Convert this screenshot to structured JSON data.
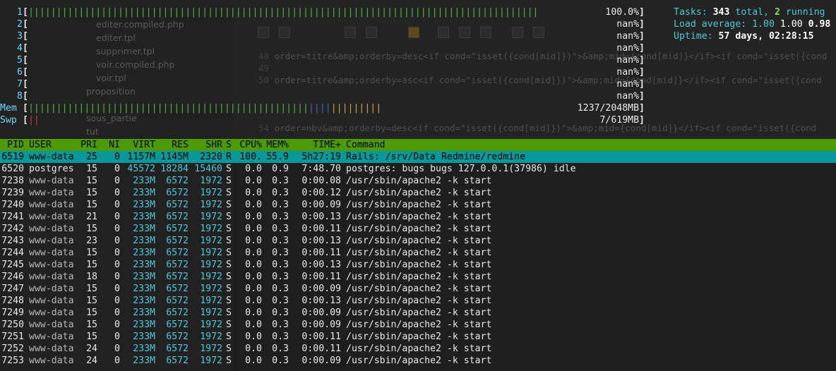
{
  "cpu_meters": [
    {
      "label": "1",
      "value": "100.0%",
      "full": true
    },
    {
      "label": "2",
      "value": "nan%",
      "full": false
    },
    {
      "label": "3",
      "value": "nan%",
      "full": false
    },
    {
      "label": "4",
      "value": "nan%",
      "full": false
    },
    {
      "label": "5",
      "value": "nan%",
      "full": false
    },
    {
      "label": "6",
      "value": "nan%",
      "full": false
    },
    {
      "label": "7",
      "value": "nan%",
      "full": false
    },
    {
      "label": "8",
      "value": "nan%",
      "full": false
    }
  ],
  "mem_meter": {
    "label": "Mem",
    "value": "1237/2048MB",
    "fraction": 0.6
  },
  "swap_meter": {
    "label": "Swp",
    "value": "7/619MB",
    "fraction": 0.01
  },
  "summary": {
    "tasks_label": "Tasks:",
    "tasks_total": "343",
    "tasks_total_suffix": "total,",
    "tasks_running": "2",
    "tasks_running_suffix": "running",
    "load_label": "Load average:",
    "load_1": "1.00",
    "load_5": "1.00",
    "load_15": "0.98",
    "uptime_label": "Uptime:",
    "uptime_value": "57 days, 02:28:15"
  },
  "columns": [
    "PID",
    "USER",
    "PRI",
    "NI",
    "VIRT",
    "RES",
    "SHR",
    "S",
    "CPU%",
    "MEM%",
    "TIME+",
    "Command"
  ],
  "processes": [
    {
      "pid": "6519",
      "user": "www-data",
      "pri": "25",
      "ni": "0",
      "virt": "1157M",
      "res": "1145M",
      "shr": "2320",
      "s": "R",
      "cpu": "100.",
      "mem": "55.9",
      "time": "5h27:19",
      "command": "Rails: /srv/Data Redmine/redmine",
      "selected": true
    },
    {
      "pid": "6520",
      "user": "postgres",
      "pri": "15",
      "ni": "0",
      "virt": "45572",
      "res": "18284",
      "shr": "15460",
      "s": "S",
      "cpu": "0.0",
      "mem": "0.9",
      "time": "7:48.70",
      "command": "postgres: bugs bugs 127.0.0.1(37986) idle"
    },
    {
      "pid": "7238",
      "user": "www-data",
      "pri": "15",
      "ni": "0",
      "virt": "233M",
      "res": "6572",
      "shr": "1972",
      "s": "S",
      "cpu": "0.0",
      "mem": "0.3",
      "time": "0:00.08",
      "command": "/usr/sbin/apache2 -k start"
    },
    {
      "pid": "7239",
      "user": "www-data",
      "pri": "15",
      "ni": "0",
      "virt": "233M",
      "res": "6572",
      "shr": "1972",
      "s": "S",
      "cpu": "0.0",
      "mem": "0.3",
      "time": "0:00.12",
      "command": "/usr/sbin/apache2 -k start"
    },
    {
      "pid": "7240",
      "user": "www-data",
      "pri": "15",
      "ni": "0",
      "virt": "233M",
      "res": "6572",
      "shr": "1972",
      "s": "S",
      "cpu": "0.0",
      "mem": "0.3",
      "time": "0:00.09",
      "command": "/usr/sbin/apache2 -k start"
    },
    {
      "pid": "7241",
      "user": "www-data",
      "pri": "21",
      "ni": "0",
      "virt": "233M",
      "res": "6572",
      "shr": "1972",
      "s": "S",
      "cpu": "0.0",
      "mem": "0.3",
      "time": "0:00.13",
      "command": "/usr/sbin/apache2 -k start"
    },
    {
      "pid": "7242",
      "user": "www-data",
      "pri": "15",
      "ni": "0",
      "virt": "233M",
      "res": "6572",
      "shr": "1972",
      "s": "S",
      "cpu": "0.0",
      "mem": "0.3",
      "time": "0:00.11",
      "command": "/usr/sbin/apache2 -k start"
    },
    {
      "pid": "7243",
      "user": "www-data",
      "pri": "23",
      "ni": "0",
      "virt": "233M",
      "res": "6572",
      "shr": "1972",
      "s": "S",
      "cpu": "0.0",
      "mem": "0.3",
      "time": "0:00.13",
      "command": "/usr/sbin/apache2 -k start"
    },
    {
      "pid": "7244",
      "user": "www-data",
      "pri": "15",
      "ni": "0",
      "virt": "233M",
      "res": "6572",
      "shr": "1972",
      "s": "S",
      "cpu": "0.0",
      "mem": "0.3",
      "time": "0:00.11",
      "command": "/usr/sbin/apache2 -k start"
    },
    {
      "pid": "7245",
      "user": "www-data",
      "pri": "15",
      "ni": "0",
      "virt": "233M",
      "res": "6572",
      "shr": "1972",
      "s": "S",
      "cpu": "0.0",
      "mem": "0.3",
      "time": "0:00.13",
      "command": "/usr/sbin/apache2 -k start"
    },
    {
      "pid": "7246",
      "user": "www-data",
      "pri": "18",
      "ni": "0",
      "virt": "233M",
      "res": "6572",
      "shr": "1972",
      "s": "S",
      "cpu": "0.0",
      "mem": "0.3",
      "time": "0:00.11",
      "command": "/usr/sbin/apache2 -k start"
    },
    {
      "pid": "7247",
      "user": "www-data",
      "pri": "15",
      "ni": "0",
      "virt": "233M",
      "res": "6572",
      "shr": "1972",
      "s": "S",
      "cpu": "0.0",
      "mem": "0.3",
      "time": "0:00.09",
      "command": "/usr/sbin/apache2 -k start"
    },
    {
      "pid": "7248",
      "user": "www-data",
      "pri": "15",
      "ni": "0",
      "virt": "233M",
      "res": "6572",
      "shr": "1972",
      "s": "S",
      "cpu": "0.0",
      "mem": "0.3",
      "time": "0:00.13",
      "command": "/usr/sbin/apache2 -k start"
    },
    {
      "pid": "7249",
      "user": "www-data",
      "pri": "15",
      "ni": "0",
      "virt": "233M",
      "res": "6572",
      "shr": "1972",
      "s": "S",
      "cpu": "0.0",
      "mem": "0.3",
      "time": "0:00.09",
      "command": "/usr/sbin/apache2 -k start"
    },
    {
      "pid": "7250",
      "user": "www-data",
      "pri": "15",
      "ni": "0",
      "virt": "233M",
      "res": "6572",
      "shr": "1972",
      "s": "S",
      "cpu": "0.0",
      "mem": "0.3",
      "time": "0:00.09",
      "command": "/usr/sbin/apache2 -k start"
    },
    {
      "pid": "7251",
      "user": "www-data",
      "pri": "15",
      "ni": "0",
      "virt": "233M",
      "res": "6572",
      "shr": "1972",
      "s": "S",
      "cpu": "0.0",
      "mem": "0.3",
      "time": "0:00.11",
      "command": "/usr/sbin/apache2 -k start"
    },
    {
      "pid": "7252",
      "user": "www-data",
      "pri": "24",
      "ni": "0",
      "virt": "233M",
      "res": "6572",
      "shr": "1972",
      "s": "S",
      "cpu": "0.0",
      "mem": "0.3",
      "time": "0:00.11",
      "command": "/usr/sbin/apache2 -k start"
    },
    {
      "pid": "7253",
      "user": "www-data",
      "pri": "24",
      "ni": "0",
      "virt": "233M",
      "res": "6572",
      "shr": "1972",
      "s": "S",
      "cpu": "0.0",
      "mem": "0.3",
      "time": "0:00.09",
      "command": "/usr/sbin/apache2 -k start"
    }
  ],
  "background_editor": {
    "files": [
      "editer.compiled.php",
      "editer.tpl",
      "supprimer.tpl",
      "voir.compiled.php",
      "voir.tpl",
      "proposition",
      "sous_partie",
      "tut"
    ],
    "code_lines": [
      {
        "n": "48",
        "text": "order=titre&amp;orderby=desc<if cond=\"isset({cond[mid]})\">&amp;mid={cond[mid]}</if><if cond=\"isset({cond"
      },
      {
        "n": "49",
        "text": ""
      },
      {
        "n": "50",
        "text": "order=titre&amp;orderby=asc<if cond=\"isset({cond[mid]})\">&amp;mid={cond[mid]}</if><if cond=\"isset({cond"
      },
      {
        "n": "54",
        "text": "order=nbv&amp;orderby=desc<if cond=\"isset({cond[mid]})\">&amp;mid={cond[mid]}</if><if cond=\"isset({cond"
      }
    ]
  },
  "colors": {
    "header_bg": "#4e9a06",
    "selected_bg": "#06989a",
    "cpu_bar": "#4fb83a",
    "mem_blue": "#3c64c8",
    "mem_yellow": "#d8a13a",
    "danger": "#d63a3a"
  }
}
